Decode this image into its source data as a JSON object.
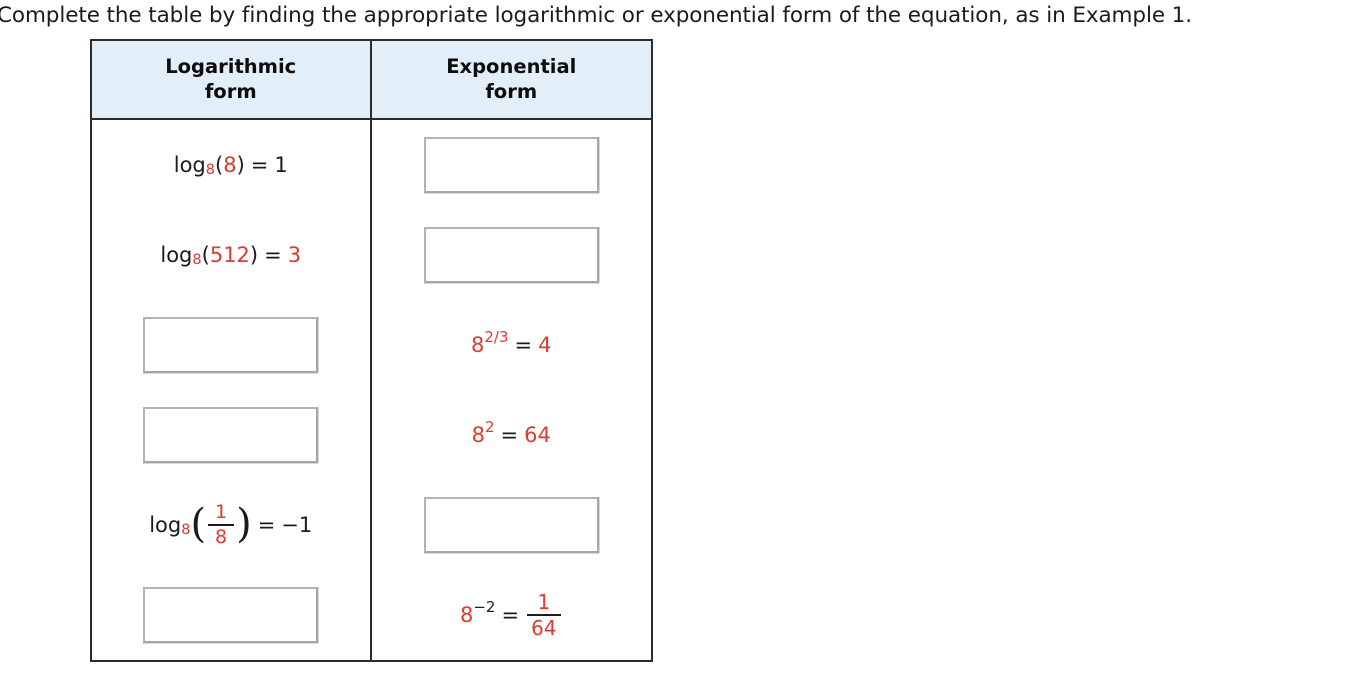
{
  "prompt": {
    "text": "Complete the table by finding the appropriate logarithmic or exponential form of the equation, as in Example 1."
  },
  "colors": {
    "header_background": "#e2eff9",
    "table_border": "#2b2b2b",
    "highlight_red": "#dd3b2e",
    "text_black": "#1b1b1b",
    "input_border": "#a6a6a6"
  },
  "table": {
    "headers": {
      "logarithmic": "Logarithmic\nform",
      "logarithmic_line1": "Logarithmic",
      "logarithmic_line2": "form",
      "exponential_line1": "Exponential",
      "exponential_line2": "form"
    },
    "rows": [
      {
        "id": "row-1",
        "logarithmic": {
          "type": "expression",
          "text": "log8(8) = 1",
          "parts": {
            "log": "log",
            "base": "8",
            "open": "(",
            "argument": "8",
            "close": ")",
            "equals": "=",
            "result": "1"
          }
        },
        "exponential": {
          "type": "input",
          "value": ""
        }
      },
      {
        "id": "row-2",
        "logarithmic": {
          "type": "expression",
          "text": "log8(512) = 3",
          "parts": {
            "log": "log",
            "base": "8",
            "open": "(",
            "argument": "512",
            "close": ")",
            "equals": "=",
            "result": "3"
          }
        },
        "exponential": {
          "type": "input",
          "value": ""
        }
      },
      {
        "id": "row-3",
        "logarithmic": {
          "type": "input",
          "value": ""
        },
        "exponential": {
          "type": "expression",
          "text": "8^(2/3) = 4",
          "parts": {
            "base": "8",
            "exponent": "2/3",
            "equals": "=",
            "result": "4"
          }
        }
      },
      {
        "id": "row-4",
        "logarithmic": {
          "type": "input",
          "value": ""
        },
        "exponential": {
          "type": "expression",
          "text": "8^2 = 64",
          "parts": {
            "base": "8",
            "exponent": "2",
            "equals": "=",
            "result": "64"
          }
        }
      },
      {
        "id": "row-5",
        "logarithmic": {
          "type": "expression",
          "text": "log8(1/8) = -1",
          "parts": {
            "log": "log",
            "base": "8",
            "open": "(",
            "numerator": "1",
            "denominator": "8",
            "close": ")",
            "equals": "=",
            "result": "−1"
          }
        },
        "exponential": {
          "type": "input",
          "value": ""
        }
      },
      {
        "id": "row-6",
        "logarithmic": {
          "type": "input",
          "value": ""
        },
        "exponential": {
          "type": "expression",
          "text": "8^-2 = 1/64",
          "parts": {
            "base": "8",
            "exponent": "−2",
            "equals": "=",
            "numerator": "1",
            "denominator": "64"
          }
        }
      }
    ]
  }
}
